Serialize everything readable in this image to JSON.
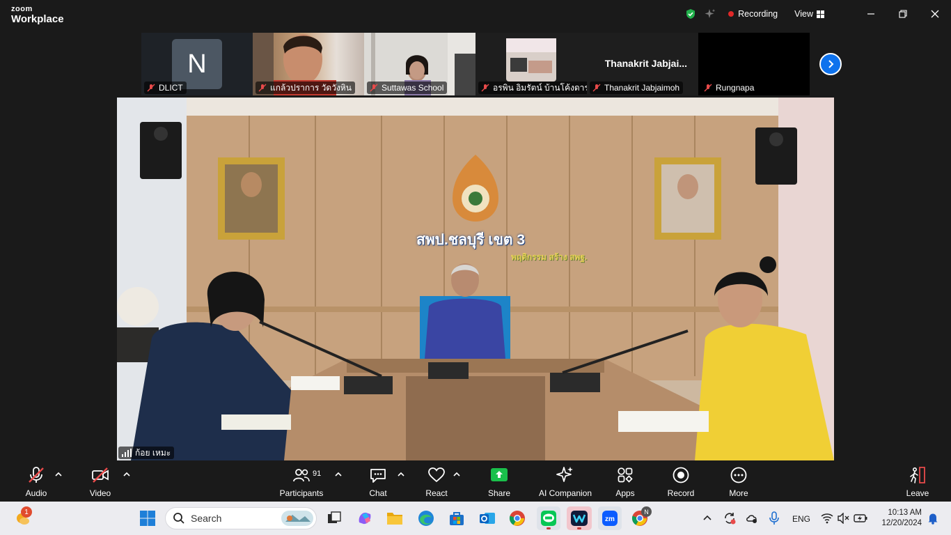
{
  "app": {
    "brand_small": "zoom",
    "brand_large": "Workplace"
  },
  "titlebar": {
    "recording_label": "Recording",
    "view_label": "View"
  },
  "thumbnails": [
    {
      "name": "DLICT",
      "avatar_letter": "N"
    },
    {
      "name": "แกล้วปราการ วัดวังหิน"
    },
    {
      "name": "Suttawas School"
    },
    {
      "name": "อรพิน อิมรัตน์ บ้านโค้งดารา"
    },
    {
      "name": "Thanakrit Jabjaimoh",
      "display_name": "Thanakrit  Jabjai..."
    },
    {
      "name": "Rungnapa"
    }
  ],
  "main_video": {
    "speaker_name": "ก้อย เหมะ",
    "sign_text": "สพป.ชลบุรี เขต 3",
    "sign_slogan": "พฤติกรรม สร้าง สพฐ."
  },
  "controls": {
    "audio": "Audio",
    "video": "Video",
    "participants": "Participants",
    "participants_count": "91",
    "chat": "Chat",
    "react": "React",
    "share": "Share",
    "ai_companion": "AI Companion",
    "apps": "Apps",
    "record": "Record",
    "more": "More",
    "leave": "Leave"
  },
  "taskbar": {
    "search_label": "Search",
    "weather_badge": "1",
    "zoom_badge": "N",
    "language": "ENG",
    "time": "10:13 AM",
    "date": "12/20/2024"
  },
  "colors": {
    "accent": "#0e72ed",
    "recording": "#e02828",
    "share": "#1ac04b"
  }
}
